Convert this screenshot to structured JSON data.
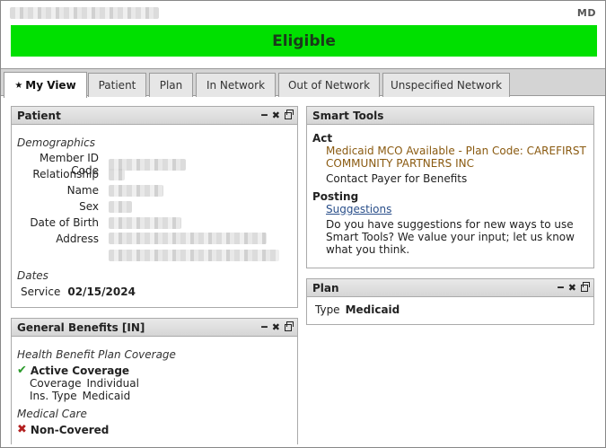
{
  "header": {
    "state_code": "MD",
    "status": "Eligible",
    "status_color": "#00e000"
  },
  "tabs": [
    {
      "label": "My View",
      "active": true
    },
    {
      "label": "Patient"
    },
    {
      "label": "Plan"
    },
    {
      "label": "In Network"
    },
    {
      "label": "Out of Network"
    },
    {
      "label": "Unspecified Network"
    }
  ],
  "patient_panel": {
    "title": "Patient",
    "demographics_label": "Demographics",
    "fields": [
      {
        "label": "Member ID Code"
      },
      {
        "label": "Relationship"
      },
      {
        "label": "Name"
      },
      {
        "label": "Sex"
      },
      {
        "label": "Date of Birth"
      },
      {
        "label": "Address"
      }
    ],
    "dates_label": "Dates",
    "service_label": "Service",
    "service_date": "02/15/2024"
  },
  "benefits_panel": {
    "title": "General Benefits [IN]",
    "coverage_section": "Health Benefit Plan Coverage",
    "active_coverage": "Active Coverage",
    "coverage_label": "Coverage",
    "coverage_value": "Individual",
    "ins_type_label": "Ins. Type",
    "ins_type_value": "Medicaid",
    "medical_care_section": "Medical Care",
    "non_covered": "Non-Covered"
  },
  "smart_tools_panel": {
    "title": "Smart Tools",
    "act_label": "Act",
    "act_line1": "Medicaid MCO Available - Plan Code: CAREFIRST",
    "act_line2": "COMMUNITY PARTNERS INC",
    "contact_text": "Contact Payer for Benefits",
    "posting_label": "Posting",
    "suggestions_link": "Suggestions",
    "suggest_line1": "Do you have suggestions for new ways to use",
    "suggest_line2": "Smart Tools? We value your input; let us know",
    "suggest_line3": "what you think."
  },
  "plan_panel": {
    "title": "Plan",
    "type_label": "Type",
    "type_value": "Medicaid"
  }
}
